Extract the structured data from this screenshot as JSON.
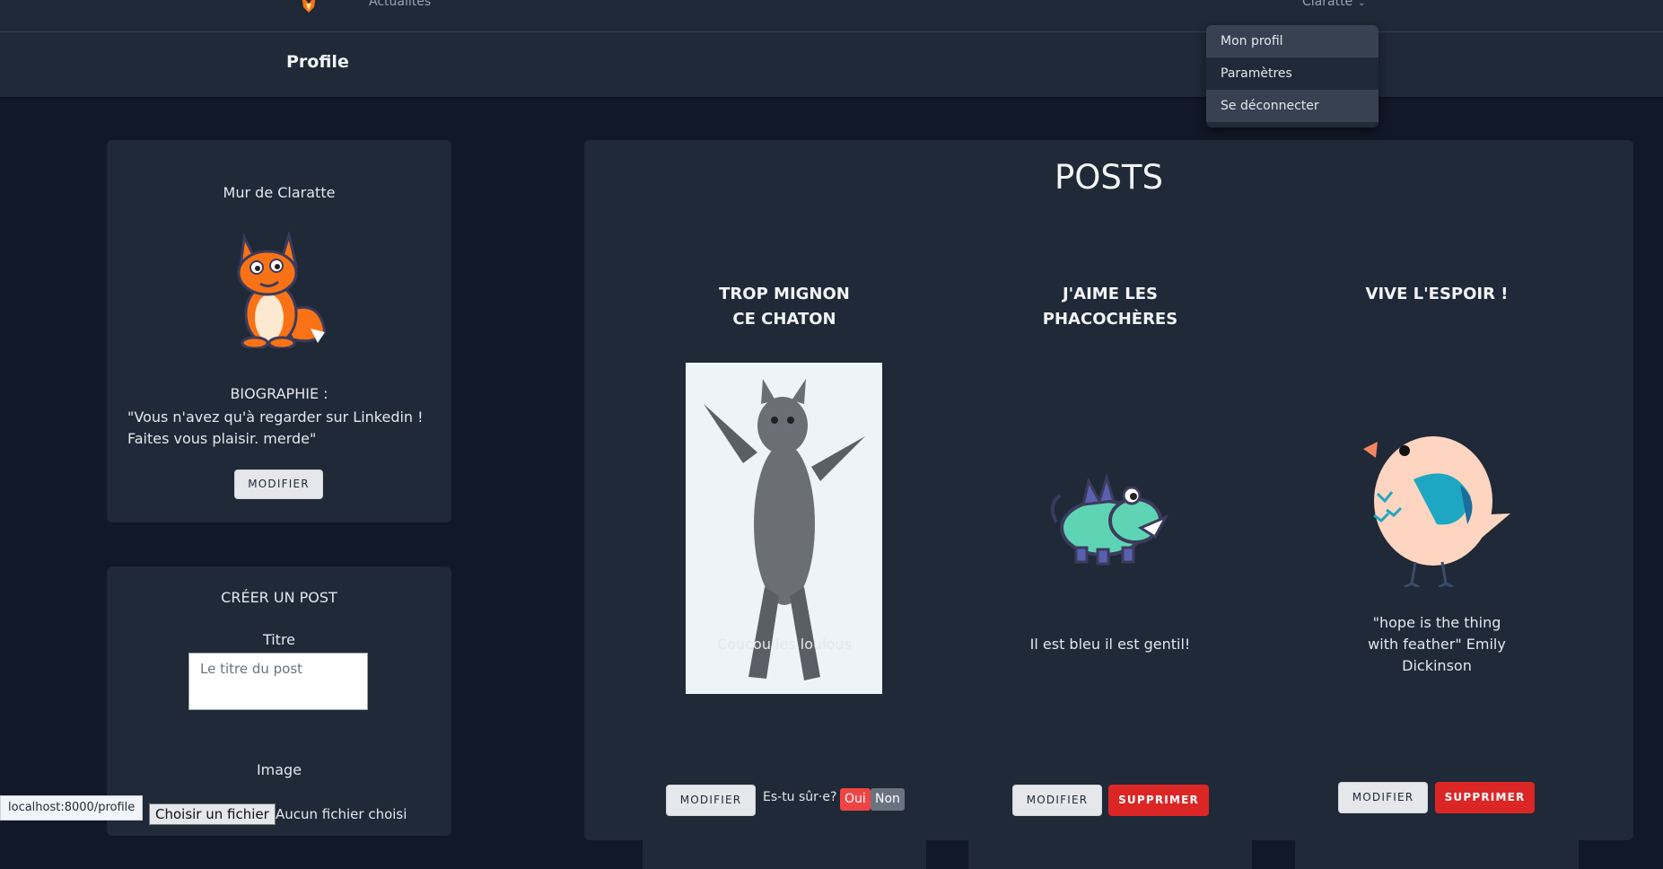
{
  "nav": {
    "link": "Actualités",
    "user": "Claratte"
  },
  "header": {
    "title": "Profile"
  },
  "dropdown": {
    "items": [
      "Mon profil",
      "Paramètres",
      "Se déconnecter"
    ]
  },
  "wall": {
    "title": "Mur de Claratte",
    "bio_label": "BIOGRAPHIE :",
    "bio_text": "\"Vous n'avez qu'à regarder sur Linkedin ! Faites vous plaisir. merde\"",
    "edit_label": "MODIFIER"
  },
  "create": {
    "title": "CRÉER UN POST",
    "titre_label": "Titre",
    "titre_placeholder": "Le titre du post",
    "image_label": "Image",
    "file_button": "Choisir un fichier",
    "file_status": "Aucun fichier choisi"
  },
  "posts": {
    "heading": "POSTS",
    "items": [
      {
        "title": "TROP MIGNON CE CHATON",
        "caption": "Coucou les loulous",
        "edit": "MODIFIER",
        "confirm": "Es-tu sûr·e?",
        "yes": "Oui",
        "no": "Non"
      },
      {
        "title": "J'AIME LES PHACOCHÈRES",
        "caption": "Il est bleu il est gentil!",
        "edit": "MODIFIER",
        "delete": "SUPPRIMER"
      },
      {
        "title": "VIVE L'ESPOIR !",
        "caption": "\"hope is the thing with feather\" Emily Dickinson",
        "edit": "MODIFIER",
        "delete": "SUPPRIMER"
      }
    ]
  },
  "status_url": "localhost:8000/profile",
  "colors": {
    "background": "#111827",
    "card": "#1f2937",
    "danger": "#dc2626",
    "confirm_yes": "#ef4444",
    "confirm_no": "#6b7280"
  },
  "icons": {
    "logo": "fox-logo-icon",
    "chevron": "chevron-down-icon"
  }
}
